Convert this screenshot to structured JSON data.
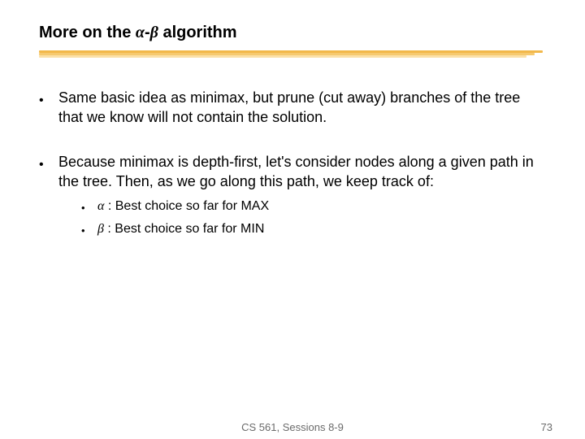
{
  "title": {
    "prefix": "More on the ",
    "alpha": "α",
    "dash": "-",
    "beta": "β",
    "suffix": " algorithm"
  },
  "bullets": [
    "Same basic idea as minimax, but prune (cut away) branches of the tree that we know will not contain the solution.",
    "Because minimax is depth-first, let's consider nodes along a given path in the tree. Then, as we go along this path, we keep track of:"
  ],
  "sub_bullets": [
    {
      "sym": "α",
      "text": " : Best choice so far for MAX"
    },
    {
      "sym": "β",
      "text": " : Best choice so far for MIN"
    }
  ],
  "footer": {
    "center": "CS 561, Sessions 8-9",
    "page": "73"
  }
}
